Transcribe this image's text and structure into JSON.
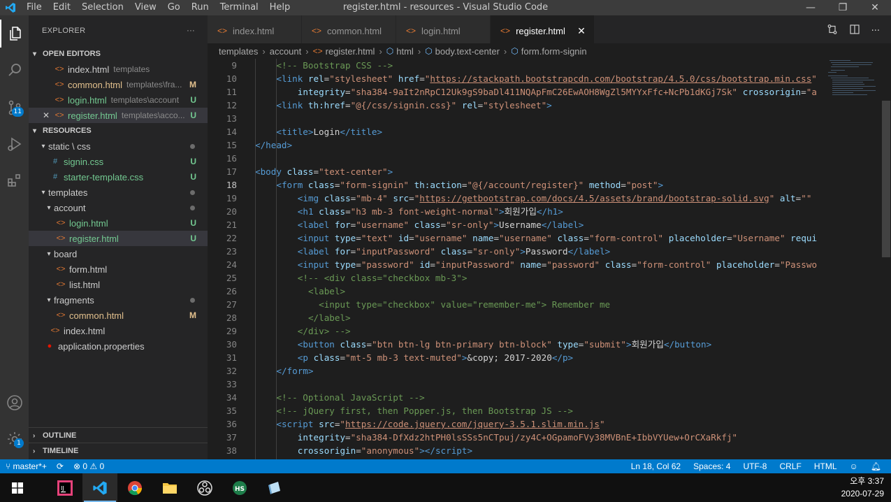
{
  "window": {
    "title": "register.html - resources - Visual Studio Code",
    "menu": [
      "File",
      "Edit",
      "Selection",
      "View",
      "Go",
      "Run",
      "Terminal",
      "Help"
    ],
    "controls": [
      "—",
      "❐",
      "✕"
    ]
  },
  "activity": {
    "icons": [
      "files-icon",
      "search-icon",
      "source-control-icon",
      "run-debug-icon",
      "extensions-icon",
      "account-icon",
      "settings-gear-icon"
    ],
    "source_control_badge": "11",
    "settings_badge": "1"
  },
  "sidebar": {
    "title": "EXPLORER",
    "more": "···",
    "open_editors_label": "OPEN EDITORS",
    "open_editors": [
      {
        "name": "index.html",
        "desc": "templates",
        "status": "",
        "cls": ""
      },
      {
        "name": "common.html",
        "desc": "templates\\fra...",
        "status": "M",
        "cls": "mod"
      },
      {
        "name": "login.html",
        "desc": "templates\\account",
        "status": "U",
        "cls": "unt"
      },
      {
        "name": "register.html",
        "desc": "templates\\acco...",
        "status": "U",
        "cls": "unt"
      }
    ],
    "close_glyph": "✕",
    "resources_label": "RESOURCES",
    "tree": [
      {
        "label": "static \\ css",
        "kind": "folder",
        "depth": 1
      },
      {
        "label": "signin.css",
        "kind": "css",
        "depth": 2,
        "status": "U"
      },
      {
        "label": "starter-template.css",
        "kind": "css",
        "depth": 2,
        "status": "U"
      },
      {
        "label": "templates",
        "kind": "folder",
        "depth": 1
      },
      {
        "label": "account",
        "kind": "folder",
        "depth": 2
      },
      {
        "label": "login.html",
        "kind": "html",
        "depth": 3,
        "status": "U"
      },
      {
        "label": "register.html",
        "kind": "html",
        "depth": 3,
        "status": "U"
      },
      {
        "label": "board",
        "kind": "folder",
        "depth": 2
      },
      {
        "label": "form.html",
        "kind": "html",
        "depth": 3
      },
      {
        "label": "list.html",
        "kind": "html",
        "depth": 3
      },
      {
        "label": "fragments",
        "kind": "folder",
        "depth": 2
      },
      {
        "label": "common.html",
        "kind": "html",
        "depth": 3,
        "status": "M"
      },
      {
        "label": "index.html",
        "kind": "html",
        "depth": 2
      },
      {
        "label": "application.properties",
        "kind": "props",
        "depth": 1
      }
    ],
    "outline_label": "OUTLINE",
    "timeline_label": "TIMELINE"
  },
  "tabs": [
    {
      "label": "index.html",
      "active": false
    },
    {
      "label": "common.html",
      "active": false
    },
    {
      "label": "login.html",
      "active": false
    },
    {
      "label": "register.html",
      "active": true
    }
  ],
  "breadcrumb": {
    "parts": [
      "templates",
      "account",
      "register.html",
      "html",
      "body.text-center",
      "form.form-signin"
    ],
    "sep": "›"
  },
  "editor": {
    "lines": [
      {
        "n": "9",
        "indent": 1,
        "html": "<span class=\"c-com\">&lt;!-- Bootstrap CSS --&gt;</span>"
      },
      {
        "n": "10",
        "indent": 1,
        "html": "<span class=\"c-tag\">&lt;link</span> <span class=\"c-attr\">rel</span>=<span class=\"c-str\">\"stylesheet\"</span> <span class=\"c-attr\">href</span>=<span class=\"c-str\">\"</span><span class=\"c-url\">https://stackpath.bootstrapcdn.com/bootstrap/4.5.0/css/bootstrap.min.css</span><span class=\"c-str\">\"</span>"
      },
      {
        "n": "11",
        "indent": 2,
        "html": "<span class=\"c-attr\">integrity</span>=<span class=\"c-str\">\"sha384-9aIt2nRpC12Uk9gS9baDl411NQApFmC26EwAOH8WgZl5MYYxFfc+NcPb1dKGj7Sk\"</span> <span class=\"c-attr\">crossorigin</span>=<span class=\"c-str\">\"a</span>"
      },
      {
        "n": "12",
        "indent": 1,
        "html": "<span class=\"c-tag\">&lt;link</span> <span class=\"c-attr\">th:href</span>=<span class=\"c-str\">\"@{/css/signin.css}\"</span> <span class=\"c-attr\">rel</span>=<span class=\"c-str\">\"stylesheet\"</span><span class=\"c-tag\">&gt;</span>"
      },
      {
        "n": "13",
        "indent": 0,
        "html": ""
      },
      {
        "n": "14",
        "indent": 1,
        "html": "<span class=\"c-tag\">&lt;title&gt;</span><span class=\"c-txt\">Login</span><span class=\"c-tag\">&lt;/title&gt;</span>"
      },
      {
        "n": "15",
        "indent": 0,
        "html": "<span class=\"c-tag\">&lt;/head&gt;</span>"
      },
      {
        "n": "16",
        "indent": 0,
        "html": ""
      },
      {
        "n": "17",
        "indent": 0,
        "html": "<span class=\"c-tag\">&lt;body</span> <span class=\"c-attr\">class</span>=<span class=\"c-str\">\"text-center\"</span><span class=\"c-tag\">&gt;</span>"
      },
      {
        "n": "18",
        "indent": 1,
        "html": "<span class=\"c-tag\">&lt;form</span> <span class=\"c-attr\">class</span>=<span class=\"c-str\">\"form-signin\"</span> <span class=\"c-attr\">th:action</span>=<span class=\"c-str\">\"@{/account/register}\"</span> <span class=\"c-attr\">method</span>=<span class=\"c-str\">\"post\"</span><span class=\"c-tag\">&gt;</span>"
      },
      {
        "n": "19",
        "indent": 2,
        "html": "<span class=\"c-tag\">&lt;img</span> <span class=\"c-attr\">class</span>=<span class=\"c-str\">\"mb-4\"</span> <span class=\"c-attr\">src</span>=<span class=\"c-str\">\"</span><span class=\"c-url\">https://getbootstrap.com/docs/4.5/assets/brand/bootstrap-solid.svg</span><span class=\"c-str\">\"</span> <span class=\"c-attr\">alt</span>=<span class=\"c-str\">\"\"</span>"
      },
      {
        "n": "20",
        "indent": 2,
        "html": "<span class=\"c-tag\">&lt;h1</span> <span class=\"c-attr\">class</span>=<span class=\"c-str\">\"h3 mb-3 font-weight-normal\"</span><span class=\"c-tag\">&gt;</span><span class=\"c-txt\">회원가입</span><span class=\"c-tag\">&lt;/h1&gt;</span>"
      },
      {
        "n": "21",
        "indent": 2,
        "html": "<span class=\"c-tag\">&lt;label</span> <span class=\"c-attr\">for</span>=<span class=\"c-str\">\"username\"</span> <span class=\"c-attr\">class</span>=<span class=\"c-str\">\"sr-only\"</span><span class=\"c-tag\">&gt;</span><span class=\"c-txt\">Username</span><span class=\"c-tag\">&lt;/label&gt;</span>"
      },
      {
        "n": "22",
        "indent": 2,
        "html": "<span class=\"c-tag\">&lt;input</span> <span class=\"c-attr\">type</span>=<span class=\"c-str\">\"text\"</span> <span class=\"c-attr\">id</span>=<span class=\"c-str\">\"username\"</span> <span class=\"c-attr\">name</span>=<span class=\"c-str\">\"username\"</span> <span class=\"c-attr\">class</span>=<span class=\"c-str\">\"form-control\"</span> <span class=\"c-attr\">placeholder</span>=<span class=\"c-str\">\"Username\"</span> <span class=\"c-attr\">requi</span>"
      },
      {
        "n": "23",
        "indent": 2,
        "html": "<span class=\"c-tag\">&lt;label</span> <span class=\"c-attr\">for</span>=<span class=\"c-str\">\"inputPassword\"</span> <span class=\"c-attr\">class</span>=<span class=\"c-str\">\"sr-only\"</span><span class=\"c-tag\">&gt;</span><span class=\"c-txt\">Password</span><span class=\"c-tag\">&lt;/label&gt;</span>"
      },
      {
        "n": "24",
        "indent": 2,
        "html": "<span class=\"c-tag\">&lt;input</span> <span class=\"c-attr\">type</span>=<span class=\"c-str\">\"password\"</span> <span class=\"c-attr\">id</span>=<span class=\"c-str\">\"inputPassword\"</span> <span class=\"c-attr\">name</span>=<span class=\"c-str\">\"password\"</span> <span class=\"c-attr\">class</span>=<span class=\"c-str\">\"form-control\"</span> <span class=\"c-attr\">placeholder</span>=<span class=\"c-str\">\"Passwo</span>"
      },
      {
        "n": "25",
        "indent": 2,
        "html": "<span class=\"c-com\">&lt;!-- &lt;div class=\"checkbox mb-3\"&gt;</span>"
      },
      {
        "n": "26",
        "indent": 2,
        "html": "<span class=\"c-com\">  &lt;label&gt;</span>"
      },
      {
        "n": "27",
        "indent": 2,
        "html": "<span class=\"c-com\">    &lt;input type=\"checkbox\" value=\"remember-me\"&gt; Remember me</span>"
      },
      {
        "n": "28",
        "indent": 2,
        "html": "<span class=\"c-com\">  &lt;/label&gt;</span>"
      },
      {
        "n": "29",
        "indent": 2,
        "html": "<span class=\"c-com\">&lt;/div&gt; --&gt;</span>"
      },
      {
        "n": "30",
        "indent": 2,
        "html": "<span class=\"c-tag\">&lt;button</span> <span class=\"c-attr\">class</span>=<span class=\"c-str\">\"btn btn-lg btn-primary btn-block\"</span> <span class=\"c-attr\">type</span>=<span class=\"c-str\">\"submit\"</span><span class=\"c-tag\">&gt;</span><span class=\"c-txt\">회원가입</span><span class=\"c-tag\">&lt;/button&gt;</span>"
      },
      {
        "n": "31",
        "indent": 2,
        "html": "<span class=\"c-tag\">&lt;p</span> <span class=\"c-attr\">class</span>=<span class=\"c-str\">\"mt-5 mb-3 text-muted\"</span><span class=\"c-tag\">&gt;</span><span class=\"c-txt\">&amp;copy; 2017-2020</span><span class=\"c-tag\">&lt;/p&gt;</span>"
      },
      {
        "n": "32",
        "indent": 1,
        "html": "<span class=\"c-tag\">&lt;/form&gt;</span>"
      },
      {
        "n": "33",
        "indent": 0,
        "html": ""
      },
      {
        "n": "34",
        "indent": 1,
        "html": "<span class=\"c-com\">&lt;!-- Optional JavaScript --&gt;</span>"
      },
      {
        "n": "35",
        "indent": 1,
        "html": "<span class=\"c-com\">&lt;!-- jQuery first, then Popper.js, then Bootstrap JS --&gt;</span>"
      },
      {
        "n": "36",
        "indent": 1,
        "html": "<span class=\"c-tag\">&lt;script</span> <span class=\"c-attr\">src</span>=<span class=\"c-str\">\"</span><span class=\"c-url\">https://code.jquery.com/jquery-3.5.1.slim.min.js</span><span class=\"c-str\">\"</span>"
      },
      {
        "n": "37",
        "indent": 2,
        "html": "<span class=\"c-attr\">integrity</span>=<span class=\"c-str\">\"sha384-DfXdz2htPH0lsSSs5nCTpuj/zy4C+OGpamoFVy38MVBnE+IbbVYUew+OrCXaRkfj\"</span>"
      },
      {
        "n": "38",
        "indent": 2,
        "html": "<span class=\"c-attr\">crossorigin</span>=<span class=\"c-str\">\"anonymous\"</span><span class=\"c-tag\">&gt;&lt;/script&gt;</span>"
      }
    ],
    "current_line": "18"
  },
  "statusbar": {
    "branch": "master*+",
    "sync": "⟳",
    "problems": "⊗ 0 ⚠ 0",
    "position": "Ln 18, Col 62",
    "spaces": "Spaces: 4",
    "encoding": "UTF-8",
    "eol": "CRLF",
    "language": "HTML"
  },
  "taskbar": {
    "apps": [
      "windows-start-icon",
      "intellij-icon",
      "vscode-icon",
      "chrome-icon",
      "file-explorer-icon",
      "obs-icon",
      "hs-app-icon",
      "notepad-icon"
    ],
    "hs_label": "HS",
    "ij_label": "IJ",
    "time": "오후 3:37",
    "date": "2020-07-29"
  },
  "colors": {
    "accent": "#007acc",
    "html_icon": "#e37933",
    "css_icon": "#519aba",
    "modified": "#e2c08d",
    "untracked": "#73c991"
  }
}
